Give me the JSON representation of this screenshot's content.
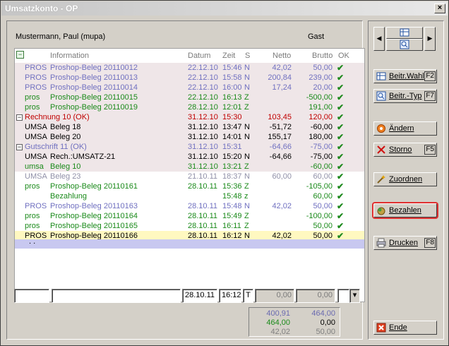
{
  "window": {
    "title": "Umsatzkonto - OP",
    "close_label": "×"
  },
  "header": {
    "customer": "Mustermann, Paul (mupa)",
    "gast": "Gast"
  },
  "columns": {
    "information": "Information",
    "datum": "Datum",
    "zeit": "Zeit",
    "s": "S",
    "netto": "Netto",
    "brutto": "Brutto",
    "ok": "OK"
  },
  "rows": [
    {
      "type": "PROS",
      "info": "Proshop-Beleg 20110012",
      "datum": "22.12.10",
      "zeit": "15:46",
      "s": "N",
      "netto": "42,02",
      "brutto": "50,00",
      "ok": "✔",
      "color": "#7070c0",
      "bg": "#efe6e8"
    },
    {
      "type": "PROS",
      "info": "Proshop-Beleg 20110013",
      "datum": "22.12.10",
      "zeit": "15:58",
      "s": "N",
      "netto": "200,84",
      "brutto": "239,00",
      "ok": "✔",
      "color": "#7070c0",
      "bg": "#efe6e8"
    },
    {
      "type": "PROS",
      "info": "Proshop-Beleg 20110014",
      "datum": "22.12.10",
      "zeit": "16:00",
      "s": "N",
      "netto": "17,24",
      "brutto": "20,00",
      "ok": "✔",
      "color": "#7070c0",
      "bg": "#efe6e8"
    },
    {
      "type": "pros",
      "info": "Proshop-Beleg 20110015",
      "datum": "22.12.10",
      "zeit": "16:13",
      "s": "Z",
      "netto": "",
      "brutto": "-500,00",
      "ok": "✔",
      "color": "#1a8a1a",
      "bg": "#efe6e8"
    },
    {
      "type": "pros",
      "info": "Proshop-Beleg 20110019",
      "datum": "28.12.10",
      "zeit": "12:01",
      "s": "Z",
      "netto": "",
      "brutto": "191,00",
      "ok": "✔",
      "color": "#1a8a1a",
      "bg": "#efe6e8"
    },
    {
      "group": "Rechnung 10 (OK)",
      "toggle": "−",
      "datum": "31.12.10",
      "zeit": "15:30",
      "s": "",
      "netto": "103,45",
      "brutto": "120,00",
      "ok": "✔",
      "color": "#c00000",
      "bg": "#efe6e8"
    },
    {
      "type": "UMSA",
      "info": "Beleg 18",
      "datum": "31.12.10",
      "zeit": "13:47",
      "s": "N",
      "netto": "-51,72",
      "brutto": "-60,00",
      "ok": "✔",
      "color": "#000000",
      "bg": "#efe6e8"
    },
    {
      "type": "UMSA",
      "info": "Beleg 20",
      "datum": "31.12.10",
      "zeit": "14:01",
      "s": "N",
      "netto": "155,17",
      "brutto": "180,00",
      "ok": "✔",
      "color": "#000000",
      "bg": "#efe6e8"
    },
    {
      "group": "Gutschrift 11 (OK)",
      "toggle": "−",
      "datum": "31.12.10",
      "zeit": "15:31",
      "s": "",
      "netto": "-64,66",
      "brutto": "-75,00",
      "ok": "✔",
      "color": "#7070c0",
      "bg": "#efe6e8"
    },
    {
      "type": "UMSA",
      "info": "Rech.:UMSATZ-21",
      "datum": "31.12.10",
      "zeit": "15:20",
      "s": "N",
      "netto": "-64,66",
      "brutto": "-75,00",
      "ok": "✔",
      "color": "#000000",
      "bg": "#efe6e8"
    },
    {
      "type": "umsa",
      "info": "Beleg 10",
      "datum": "31.12.10",
      "zeit": "13:21",
      "s": "Z",
      "netto": "",
      "brutto": "-60,00",
      "ok": "✔",
      "color": "#1a8a1a",
      "bg": "#efe6e8"
    },
    {
      "type": "UMSA",
      "info": "Beleg 23",
      "datum": "21.10.11",
      "zeit": "18:37",
      "s": "N",
      "netto": "60,00",
      "brutto": "60,00",
      "ok": "✔",
      "color": "#9090a8",
      "bg": "#ffffff"
    },
    {
      "type": "pros",
      "info": "Proshop-Beleg 20110161",
      "datum": "28.10.11",
      "zeit": "15:36",
      "s": "Z",
      "netto": "",
      "brutto": "-105,00",
      "ok": "✔",
      "color": "#1a8a1a",
      "bg": "#ffffff"
    },
    {
      "type": "",
      "info": "Bezahlung",
      "datum": "",
      "zeit": "15:48",
      "s": "z",
      "netto": "",
      "brutto": "60,00",
      "ok": "✔",
      "color": "#1a8a1a",
      "bg": "#ffffff"
    },
    {
      "type": "PROS",
      "info": "Proshop-Beleg 20110163",
      "datum": "28.10.11",
      "zeit": "15:48",
      "s": "N",
      "netto": "42,02",
      "brutto": "50,00",
      "ok": "✔",
      "color": "#7070c0",
      "bg": "#ffffff"
    },
    {
      "type": "pros",
      "info": "Proshop-Beleg 20110164",
      "datum": "28.10.11",
      "zeit": "15:49",
      "s": "Z",
      "netto": "",
      "brutto": "-100,00",
      "ok": "✔",
      "color": "#1a8a1a",
      "bg": "#ffffff"
    },
    {
      "type": "pros",
      "info": "Proshop-Beleg 20110165",
      "datum": "28.10.11",
      "zeit": "16:11",
      "s": "Z",
      "netto": "",
      "brutto": "50,00",
      "ok": "✔",
      "color": "#1a8a1a",
      "bg": "#ffffff"
    },
    {
      "type": "PROS",
      "info": "Proshop-Beleg 20110166",
      "datum": "28.10.11",
      "zeit": "16:12",
      "s": "N",
      "netto": "42,02",
      "brutto": "50,00",
      "ok": "✔",
      "color": "#000000",
      "bg": "#fff8c0"
    }
  ],
  "ellipsis": ". .",
  "inputs": {
    "datum": "28.10.11",
    "zeit": "16:12",
    "s": "T",
    "netto": "0,00",
    "brutto": "0,00"
  },
  "totals": [
    {
      "netto": "400,91",
      "brutto": "464,00",
      "color": "#6a6ab0"
    },
    {
      "netto": "464,00",
      "brutto": "0,00",
      "color": "#1a8a1a",
      "brutto_color": "#000000"
    },
    {
      "netto": "42,02",
      "brutto": "50,00",
      "color": "#808080"
    }
  ],
  "buttons": {
    "beitr_wahl": {
      "label": "Beitr.Wahl",
      "key": "F2"
    },
    "beitr_typ": {
      "label": "Beitr.-Typ",
      "key": "F7"
    },
    "aendern": {
      "label": "Ändern"
    },
    "storno": {
      "label": "Storno",
      "key": "F5"
    },
    "zuordnen": {
      "label": "Zuordnen"
    },
    "bezahlen": {
      "label": "Bezahlen"
    },
    "drucken": {
      "label": "Drucken",
      "key": "F8"
    },
    "ende": {
      "label": "Ende"
    }
  }
}
